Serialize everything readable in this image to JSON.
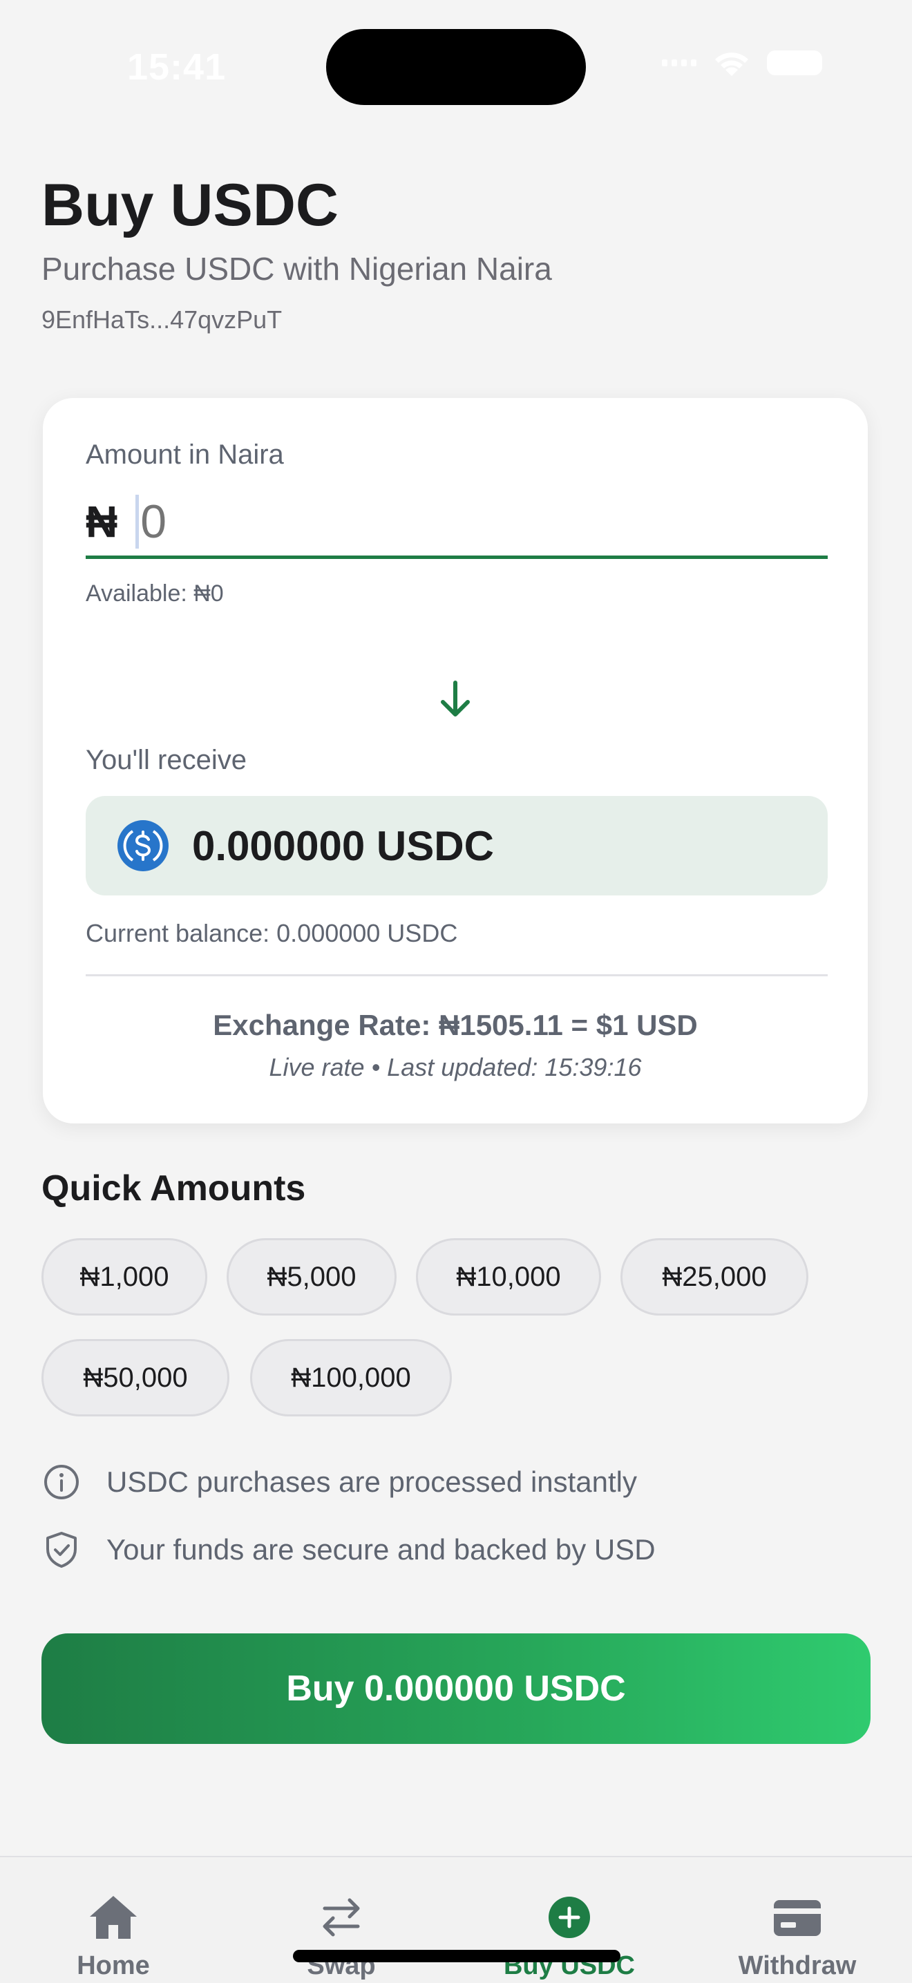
{
  "status_bar": {
    "time": "15:41"
  },
  "header": {
    "title": "Buy USDC",
    "subtitle": "Purchase USDC with Nigerian Naira",
    "wallet_address": "9EnfHaTs...47qvzPuT"
  },
  "amount": {
    "label": "Amount in Naira",
    "currency_symbol": "₦",
    "value": "",
    "placeholder": "0",
    "available": "Available: ₦0"
  },
  "receive": {
    "label": "You'll receive",
    "amount": "0.000000 USDC",
    "balance": "Current balance: 0.000000 USDC"
  },
  "rate": {
    "text": "Exchange Rate: ₦1505.11 = $1 USD",
    "updated": "Live rate • Last updated: 15:39:16"
  },
  "quick_amounts": {
    "title": "Quick Amounts",
    "items": [
      "₦1,000",
      "₦5,000",
      "₦10,000",
      "₦25,000",
      "₦50,000",
      "₦100,000"
    ]
  },
  "info": [
    {
      "icon": "info-icon",
      "text": "USDC purchases are processed instantly"
    },
    {
      "icon": "shield-check-icon",
      "text": "Your funds are secure and backed by USD"
    }
  ],
  "cta": {
    "label": "Buy 0.000000 USDC"
  },
  "tabs": [
    {
      "icon": "home-icon",
      "label": "Home",
      "active": false
    },
    {
      "icon": "swap-icon",
      "label": "Swap",
      "active": false
    },
    {
      "icon": "plus-circle-icon",
      "label": "Buy USDC",
      "active": true
    },
    {
      "icon": "card-icon",
      "label": "Withdraw",
      "active": false
    }
  ],
  "colors": {
    "accent": "#1e7d45",
    "accent_light": "#2fcb6f",
    "receive_bg": "#e6efea",
    "usdc_blue": "#2775ca"
  }
}
